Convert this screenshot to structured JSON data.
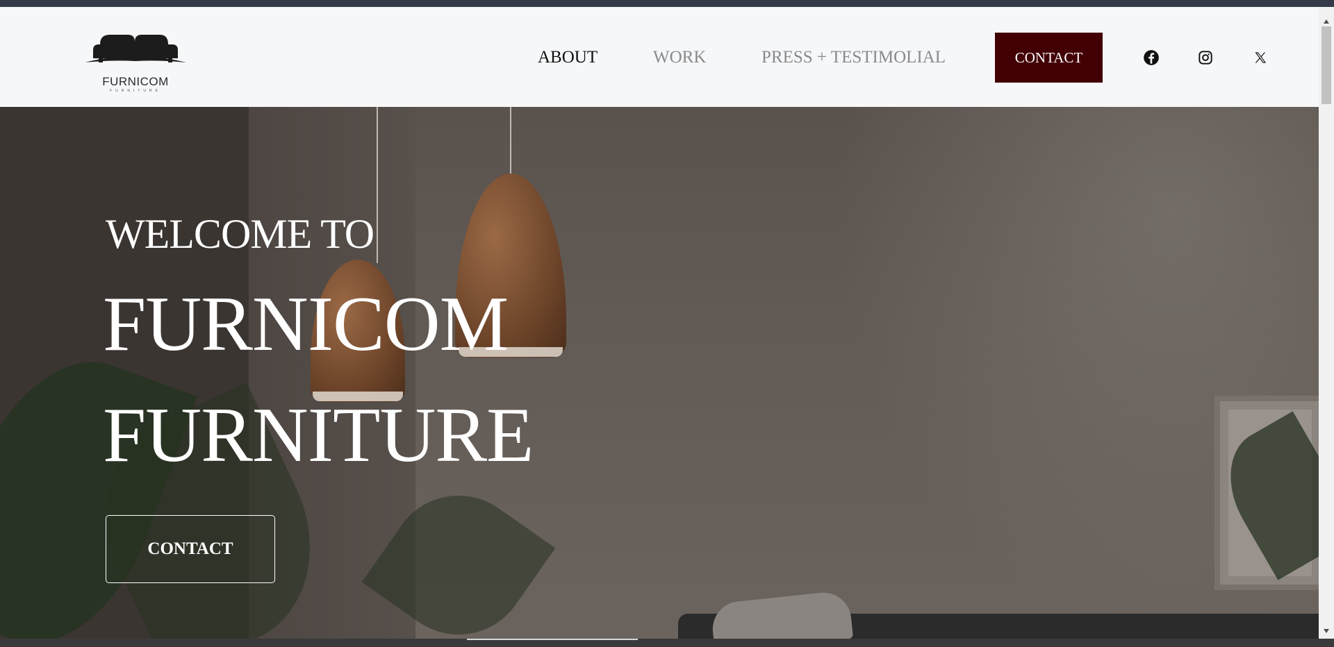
{
  "brand": {
    "name": "FURNICOM",
    "tagline": "FURNITURE"
  },
  "nav": {
    "about": "ABOUT",
    "work": "WORK",
    "press": "PRESS + TESTIMOLIAL",
    "contact": "CONTACT"
  },
  "social": [
    {
      "icon": "facebook-icon"
    },
    {
      "icon": "instagram-icon"
    },
    {
      "icon": "x-icon"
    }
  ],
  "hero": {
    "welcome": "WELCOME TO",
    "title_line1": "FURNICOM",
    "title_line2": "FURNITURE",
    "cta": "CONTACT"
  },
  "colors": {
    "accent": "#420004",
    "header_bg": "#f6f7f9",
    "nav_active": "#111111",
    "nav_inactive": "#8a8a8a"
  }
}
